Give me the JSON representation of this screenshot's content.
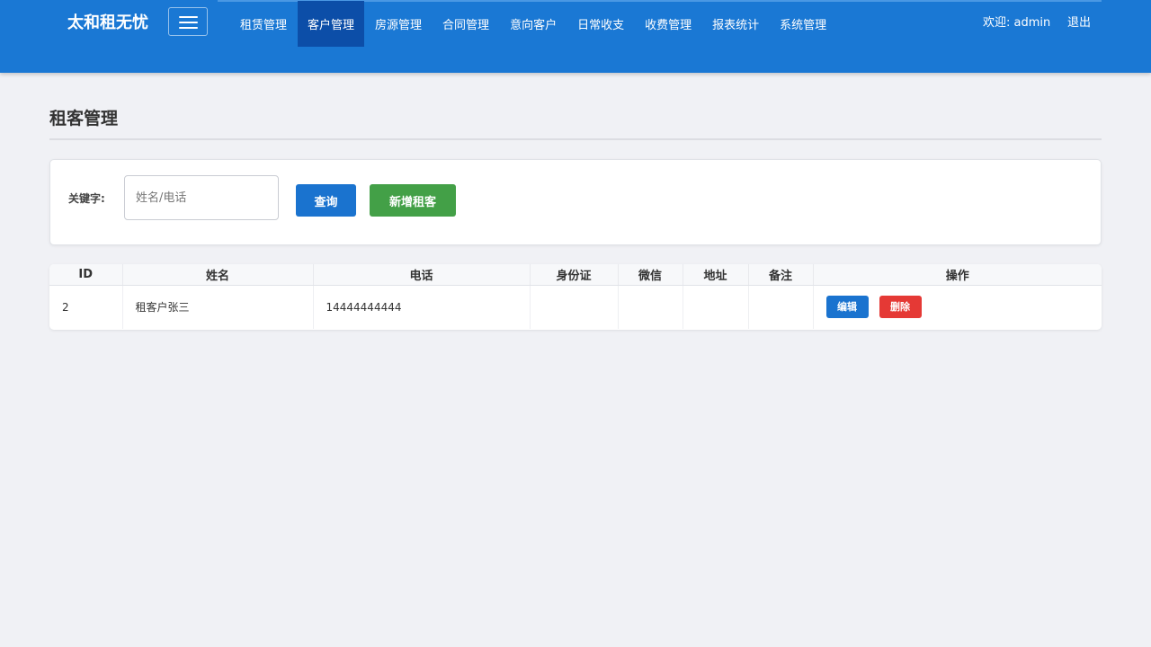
{
  "header": {
    "brand": "太和租无忧",
    "nav": [
      {
        "label": "租赁管理",
        "active": false
      },
      {
        "label": "客户管理",
        "active": true
      },
      {
        "label": "房源管理",
        "active": false
      },
      {
        "label": "合同管理",
        "active": false
      },
      {
        "label": "意向客户",
        "active": false
      },
      {
        "label": "日常收支",
        "active": false
      },
      {
        "label": "收费管理",
        "active": false
      },
      {
        "label": "报表统计",
        "active": false
      },
      {
        "label": "系统管理",
        "active": false
      }
    ],
    "welcome": "欢迎: admin",
    "logout": "退出",
    "colors": {
      "bar": "#1a78d4",
      "active": "#0c4ea8"
    }
  },
  "page": {
    "title": "租客管理"
  },
  "search": {
    "label": "关键字:",
    "value": "",
    "placeholder": "姓名/电话",
    "query_button": "查询",
    "add_button": "新增租客"
  },
  "table": {
    "columns": [
      "ID",
      "姓名",
      "电话",
      "身份证",
      "微信",
      "地址",
      "备注",
      "操作"
    ],
    "rows": [
      {
        "id": "2",
        "name": "租客户张三",
        "phone": "14444444444",
        "idcard": "",
        "wechat": "",
        "address": "",
        "remark": "",
        "actions": {
          "edit": "编辑",
          "delete": "删除"
        }
      }
    ]
  },
  "icons": {
    "menu": "hamburger-menu-icon"
  },
  "button_colors": {
    "primary": "#1a73cf",
    "success": "#43a047",
    "danger": "#e53935"
  }
}
